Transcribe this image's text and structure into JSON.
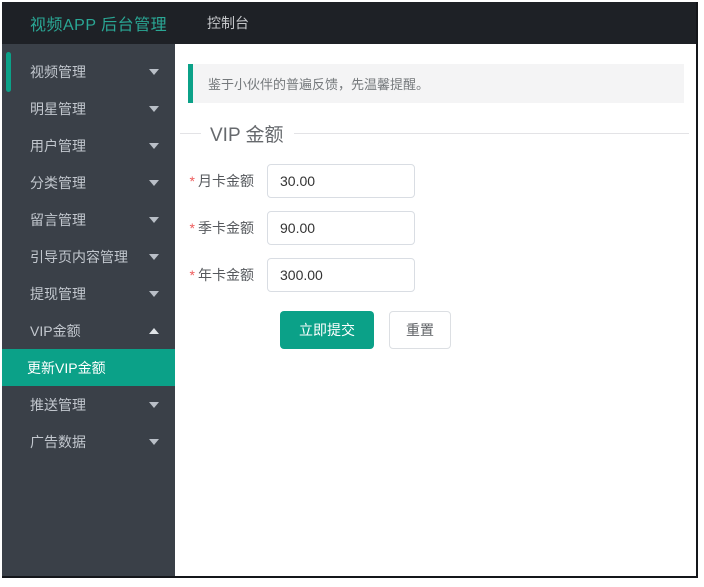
{
  "header": {
    "logo": "视频APP 后台管理",
    "nav_tab": "控制台"
  },
  "sidebar": {
    "items": [
      {
        "label": "视频管理",
        "state": "collapsed"
      },
      {
        "label": "明星管理",
        "state": "collapsed"
      },
      {
        "label": "用户管理",
        "state": "collapsed"
      },
      {
        "label": "分类管理",
        "state": "collapsed"
      },
      {
        "label": "留言管理",
        "state": "collapsed"
      },
      {
        "label": "引导页内容管理",
        "state": "collapsed"
      },
      {
        "label": "提现管理",
        "state": "collapsed"
      },
      {
        "label": "VIP金额",
        "state": "expanded"
      },
      {
        "label": "推送管理",
        "state": "collapsed"
      },
      {
        "label": "广告数据",
        "state": "collapsed"
      }
    ],
    "submenu": {
      "label": "更新VIP金额",
      "active": true
    }
  },
  "notice": {
    "text": "鉴于小伙伴的普遍反馈，先温馨提醒。"
  },
  "section": {
    "title": "VIP 金额"
  },
  "form": {
    "required_marker": "*",
    "fields": [
      {
        "label": "月卡金额",
        "value": "30.00"
      },
      {
        "label": "季卡金额",
        "value": "90.00"
      },
      {
        "label": "年卡金额",
        "value": "300.00"
      }
    ],
    "submit_label": "立即提交",
    "reset_label": "重置"
  },
  "colors": {
    "accent_teal": "#0ba188",
    "topbar_bg": "#1e2126",
    "sidebar_bg": "#3a4048",
    "required_red": "#ee5b5b"
  }
}
